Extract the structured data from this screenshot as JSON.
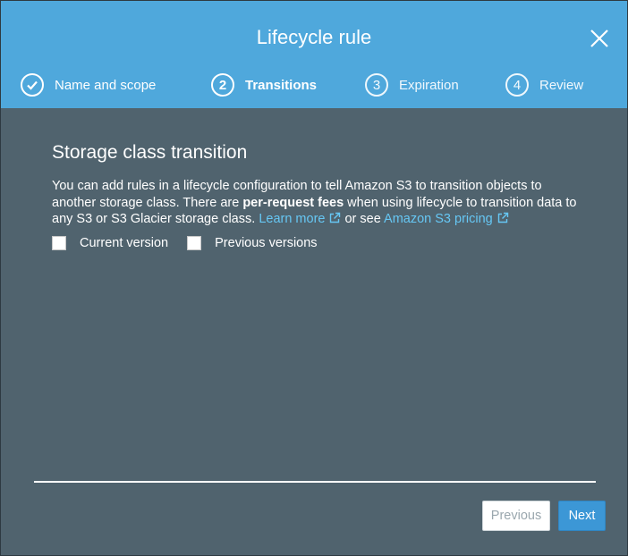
{
  "dialog": {
    "title": "Lifecycle rule",
    "close_icon": "close-icon"
  },
  "steps": [
    {
      "number": "",
      "label": "Name and scope",
      "state": "completed",
      "icon": "check-circle-icon"
    },
    {
      "number": "2",
      "label": "Transitions",
      "state": "active"
    },
    {
      "number": "3",
      "label": "Expiration",
      "state": "upcoming"
    },
    {
      "number": "4",
      "label": "Review",
      "state": "upcoming"
    }
  ],
  "section": {
    "title": "Storage class transition",
    "desc_part1": "You can add rules in a lifecycle configuration to tell Amazon S3 to transition objects to another storage class. There are ",
    "desc_bold": "per-request fees",
    "desc_part2": " when using lifecycle to transition data to any S3 or S3 Glacier storage class. ",
    "learn_more": "Learn more",
    "or_see": " or see ",
    "pricing_link": "Amazon S3 pricing",
    "external_icon": "external-link-icon"
  },
  "options": {
    "current_version": {
      "label": "Current version",
      "checked": false
    },
    "previous_versions": {
      "label": "Previous versions",
      "checked": false
    }
  },
  "footer": {
    "previous_label": "Previous",
    "next_label": "Next"
  },
  "colors": {
    "header": "#4fa8dc",
    "body": "#50636e",
    "link": "#66c7f4",
    "primary_button": "#3c97d6"
  }
}
